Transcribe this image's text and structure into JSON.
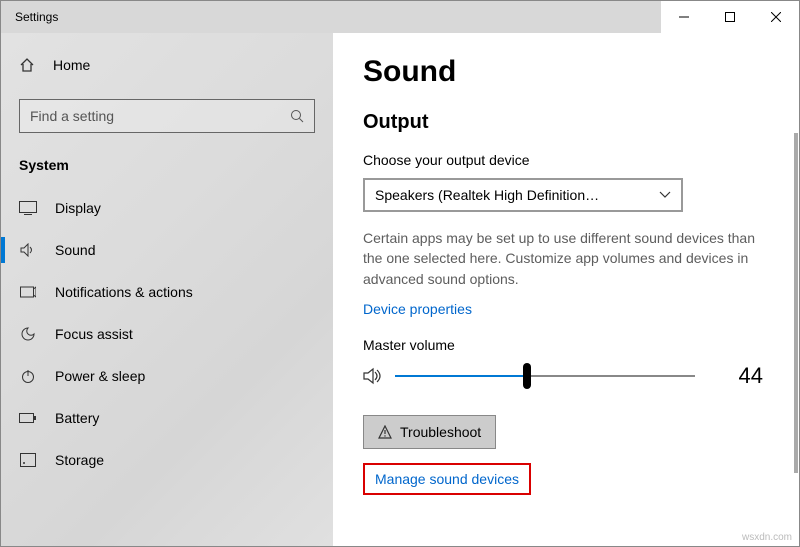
{
  "window": {
    "title": "Settings"
  },
  "sidebar": {
    "home": "Home",
    "search_placeholder": "Find a setting",
    "category": "System",
    "items": [
      {
        "label": "Display"
      },
      {
        "label": "Sound"
      },
      {
        "label": "Notifications & actions"
      },
      {
        "label": "Focus assist"
      },
      {
        "label": "Power & sleep"
      },
      {
        "label": "Battery"
      },
      {
        "label": "Storage"
      }
    ]
  },
  "main": {
    "page_title": "Sound",
    "output": {
      "title": "Output",
      "choose_label": "Choose your output device",
      "device": "Speakers (Realtek High Definition…",
      "help": "Certain apps may be set up to use different sound devices than the one selected here. Customize app volumes and devices in advanced sound options.",
      "device_properties": "Device properties",
      "master_volume_label": "Master volume",
      "volume_value": "44",
      "troubleshoot": "Troubleshoot",
      "manage": "Manage sound devices"
    }
  },
  "watermark": "wsxdn.com"
}
